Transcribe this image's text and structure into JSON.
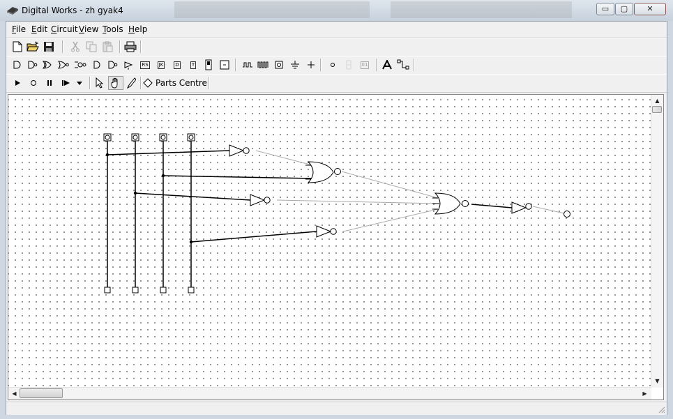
{
  "window": {
    "title": "Digital Works - zh gyak4",
    "controls": {
      "minimize": "▭",
      "maximize": "▢",
      "close": "✕"
    }
  },
  "menu": [
    {
      "label": "File",
      "access_key": "F",
      "rest": "ile"
    },
    {
      "label": "Edit",
      "access_key": "E",
      "rest": "dit"
    },
    {
      "label": "Circuit",
      "access_key": "C",
      "rest": "ircuit"
    },
    {
      "label": "View",
      "access_key": "V",
      "rest": "iew"
    },
    {
      "label": "Tools",
      "access_key": "T",
      "rest": "ools"
    },
    {
      "label": "Help",
      "access_key": "H",
      "rest": "elp"
    }
  ],
  "toolbar_standard": {
    "buttons": [
      "new-icon",
      "open-icon",
      "save-icon",
      "cut-icon",
      "copy-icon",
      "paste-icon",
      "print-icon"
    ]
  },
  "toolbar_components": {
    "buttons": [
      "and-gate-icon",
      "nand-gate-icon",
      "or-gate-icon",
      "nor-gate-icon",
      "xnor-gate-icon",
      "buffer-gate-icon",
      "not-gate-icon",
      "tristate-gate-icon",
      "rs-flipflop-icon",
      "jk-flipflop-icon",
      "d-flipflop-icon",
      "t-flipflop-icon",
      "led-icon",
      "switch-icon",
      "clock-icon",
      "pulse-icon",
      "input-terminal-icon",
      "ground-icon",
      "wire-junction-icon",
      "output-terminal-icon",
      "seven-segment-icon",
      "hex-display-icon",
      "text-tool-icon",
      "wire-tool-icon"
    ],
    "labels": {
      "rs": "RS",
      "jk": "JK",
      "d": "D",
      "t": "T",
      "hex": "01"
    }
  },
  "toolbar_simulation": {
    "buttons": [
      "run-icon",
      "stop-icon",
      "pause-icon",
      "step-icon",
      "dropdown-icon",
      "pointer-icon",
      "hand-icon",
      "probe-icon"
    ],
    "parts_centre_label": "Parts Centre"
  },
  "canvas": {
    "grid": true,
    "circuit": {
      "inputs": 4,
      "outputs": 1,
      "gates": [
        "NOT",
        "OR",
        "NOT",
        "NOT",
        "NOR",
        "NOT"
      ]
    }
  },
  "scrollbars": {
    "up": "▲",
    "down": "▼",
    "left": "◀",
    "right": "▶"
  }
}
